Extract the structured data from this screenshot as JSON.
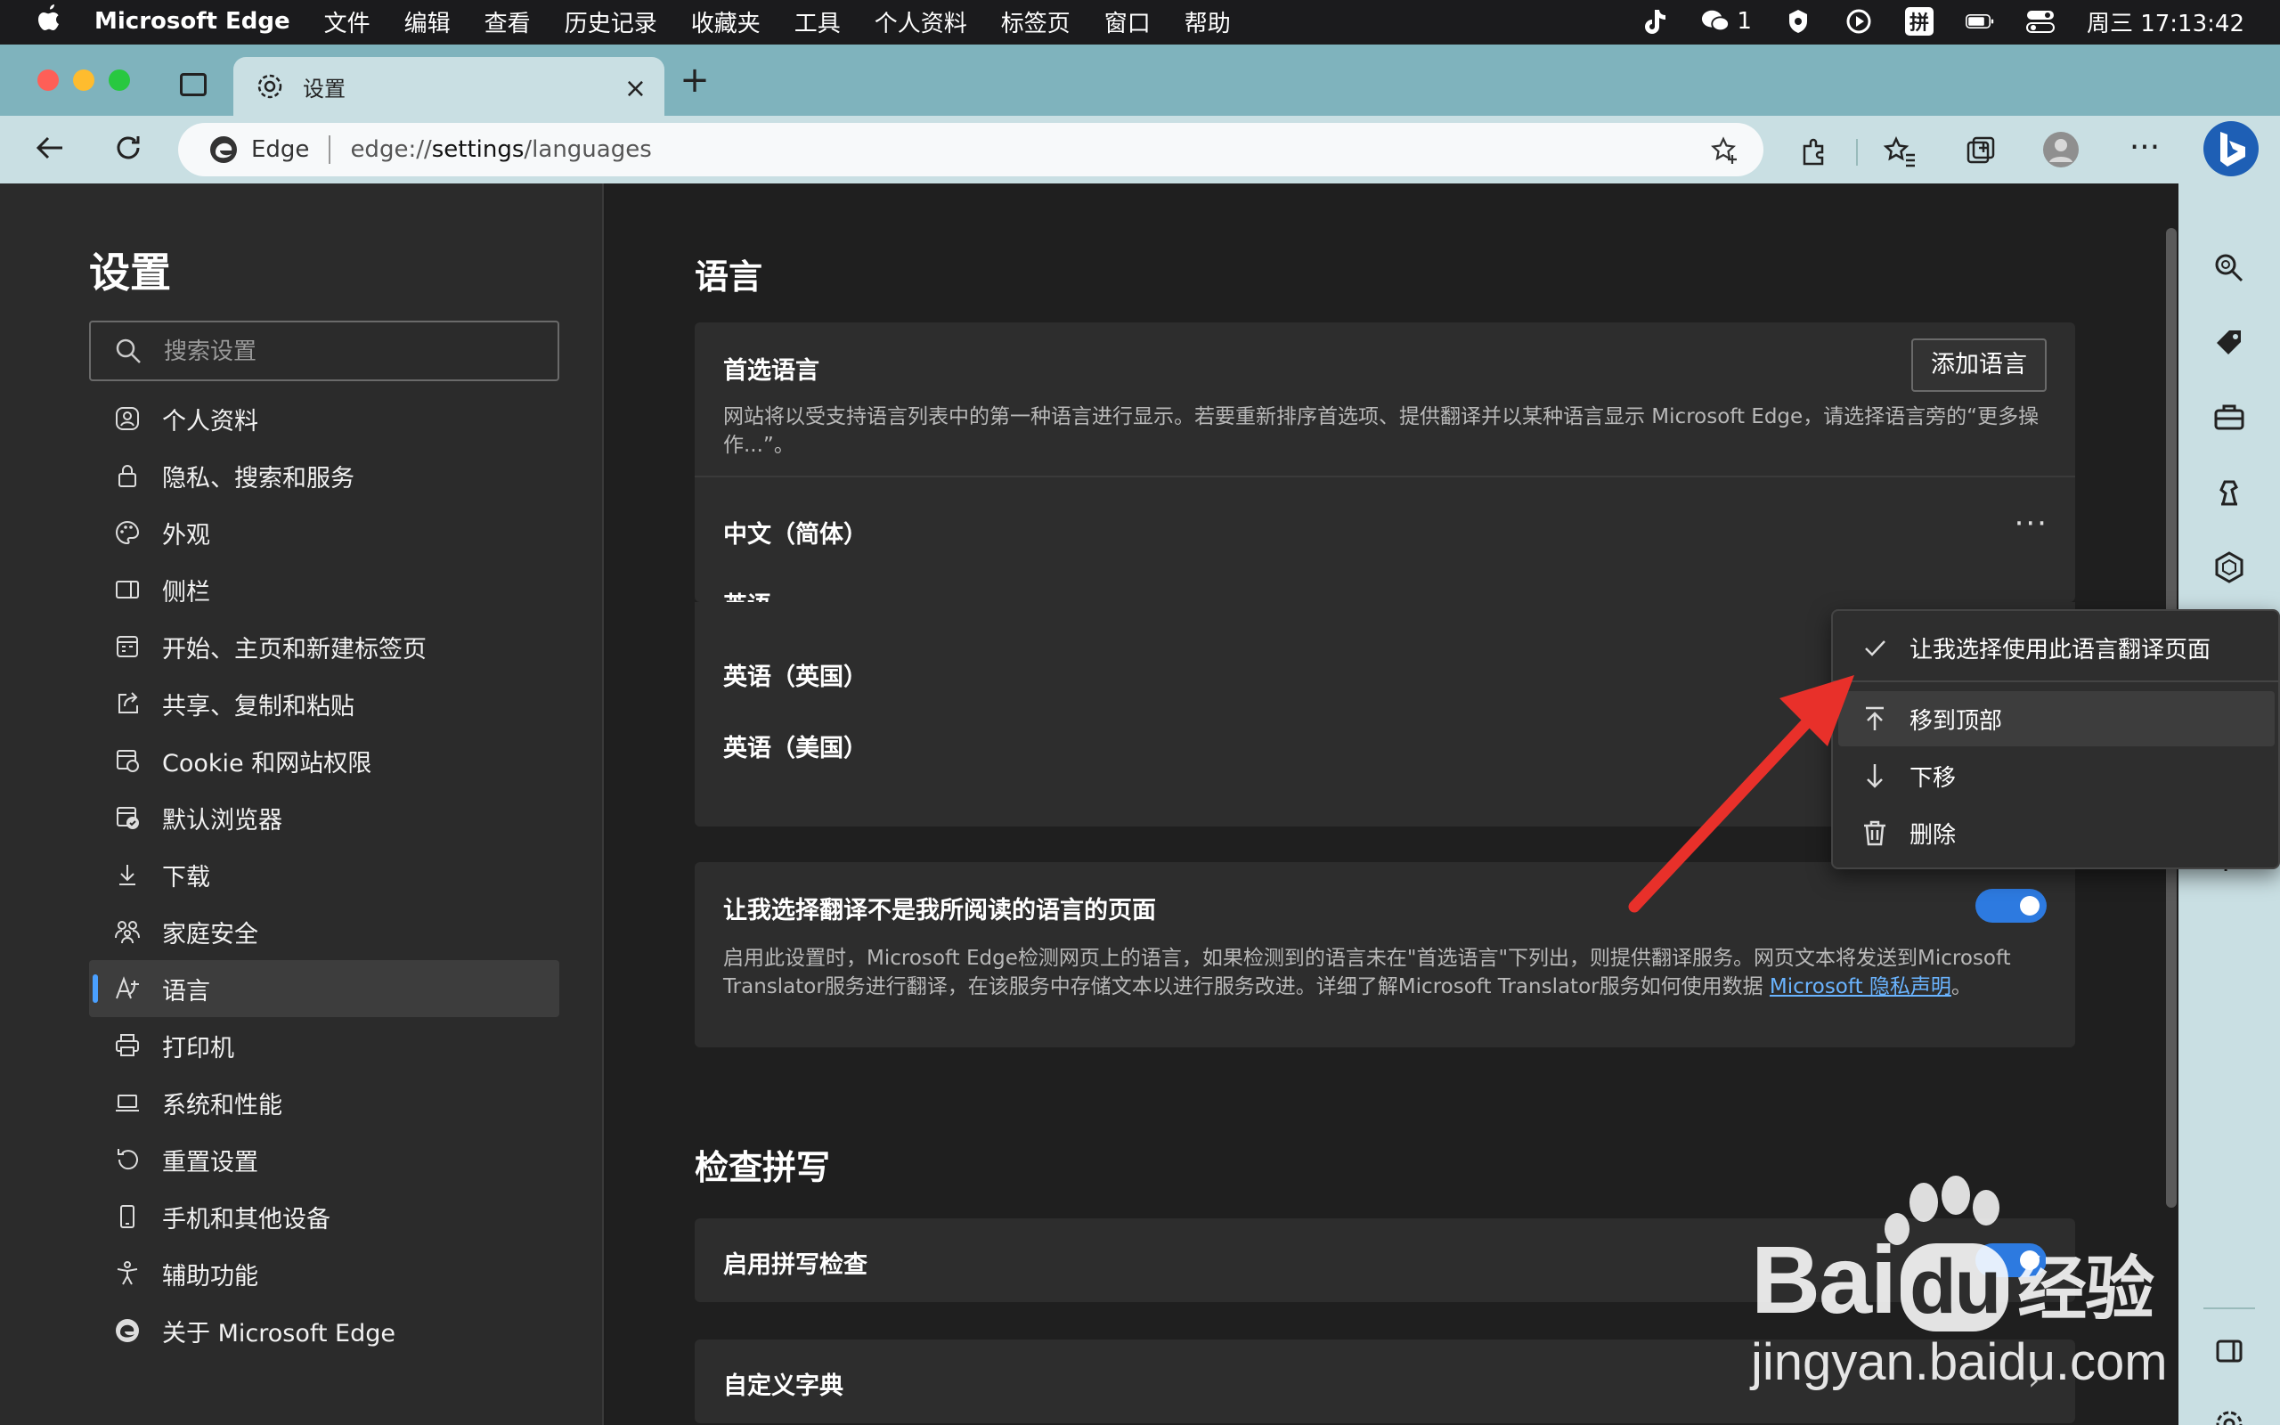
{
  "menubar": {
    "app_name": "Microsoft Edge",
    "items": [
      "文件",
      "编辑",
      "查看",
      "历史记录",
      "收藏夹",
      "工具",
      "个人资料",
      "标签页",
      "窗口",
      "帮助"
    ],
    "wechat_count": "1",
    "input_method": "拼",
    "clock": "周三  17:13:42"
  },
  "tab": {
    "title": "设置"
  },
  "address": {
    "site_label": "Edge",
    "url_prefix": "edge://",
    "url_host": "settings",
    "url_path": "/languages"
  },
  "sidebar": {
    "title": "设置",
    "search_placeholder": "搜索设置",
    "items": [
      {
        "label": "个人资料",
        "icon": "profile-icon"
      },
      {
        "label": "隐私、搜索和服务",
        "icon": "lock-icon"
      },
      {
        "label": "外观",
        "icon": "palette-icon"
      },
      {
        "label": "侧栏",
        "icon": "sidebar-icon"
      },
      {
        "label": "开始、主页和新建标签页",
        "icon": "home-icon"
      },
      {
        "label": "共享、复制和粘贴",
        "icon": "share-icon"
      },
      {
        "label": "Cookie 和网站权限",
        "icon": "cookie-icon"
      },
      {
        "label": "默认浏览器",
        "icon": "browser-icon"
      },
      {
        "label": "下载",
        "icon": "download-icon"
      },
      {
        "label": "家庭安全",
        "icon": "family-icon"
      },
      {
        "label": "语言",
        "icon": "language-icon"
      },
      {
        "label": "打印机",
        "icon": "printer-icon"
      },
      {
        "label": "系统和性能",
        "icon": "laptop-icon"
      },
      {
        "label": "重置设置",
        "icon": "reset-icon"
      },
      {
        "label": "手机和其他设备",
        "icon": "phone-icon"
      },
      {
        "label": "辅助功能",
        "icon": "accessibility-icon"
      },
      {
        "label": "关于 Microsoft Edge",
        "icon": "edge-logo-icon"
      }
    ],
    "active_index": 10
  },
  "languages": {
    "heading": "语言",
    "preferred_title": "首选语言",
    "add_button": "添加语言",
    "preferred_desc": "网站将以受支持语言列表中的第一种语言进行显示。若要重新排序首选项、提供翻译并以某种语言显示 Microsoft Edge，请选择语言旁的“更多操作...”。",
    "list": [
      "中文（简体）",
      "英语",
      "英语（英国）",
      "英语（美国）"
    ],
    "more_actions": "···",
    "translate_title": "让我选择翻译不是我所阅读的语言的页面",
    "translate_desc": "启用此设置时，Microsoft Edge检测网页上的语言，如果检测到的语言未在\"首选语言\"下列出，则提供翻译服务。网页文本将发送到Microsoft Translator服务进行翻译，在该服务中存储文本以进行服务改进。详细了解Microsoft Translator服务如何使用数据",
    "translate_link": "Microsoft 隐私声明",
    "translate_tail": "。",
    "translate_toggle_on": true
  },
  "spellcheck": {
    "heading": "检查拼写",
    "enable_label": "启用拼写检查",
    "enable_on": true,
    "custom_dict": "自定义字典"
  },
  "context_menu": {
    "items": [
      {
        "label": "让我选择使用此语言翻译页面",
        "icon": "checkmark-icon"
      },
      {
        "label": "移到顶部",
        "icon": "move-top-icon"
      },
      {
        "label": "下移",
        "icon": "arrow-down-icon"
      },
      {
        "label": "删除",
        "icon": "trash-icon"
      }
    ]
  },
  "watermark": {
    "brand": "Bai",
    "brand2": "du",
    "cn": "经验",
    "url": "jingyan.baidu.com"
  },
  "colors": {
    "accent": "#2d7ae0",
    "annotation_arrow": "#e8302a",
    "tab_bg": "#c9dfe3",
    "tabbar_bg": "#7fb3bd"
  }
}
